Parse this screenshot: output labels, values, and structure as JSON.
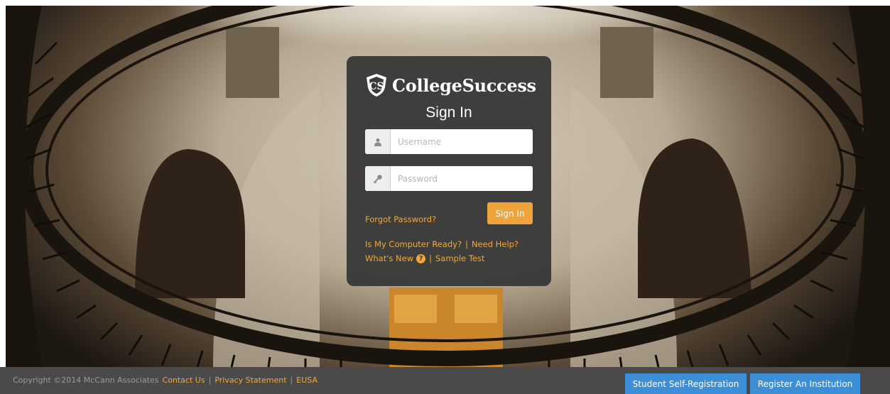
{
  "brand": {
    "name": "CollegeSuccess",
    "logo_icon": "cs-shield-icon"
  },
  "login": {
    "title": "Sign In",
    "username_placeholder": "Username",
    "password_placeholder": "Password",
    "username_icon": "user-icon",
    "password_icon": "key-icon",
    "forgot_label": "Forgot Password?",
    "signin_label": "Sign In"
  },
  "links": {
    "computer_ready": "Is My Computer Ready?",
    "need_help": "Need Help?",
    "whats_new": "What's New",
    "sample_test": "Sample Test",
    "separator": "|"
  },
  "footer": {
    "copyright": "Copyright ©2014 McCann Associates",
    "contact": "Contact Us",
    "privacy": "Privacy Statement",
    "eusa": "EUSA",
    "separator": "|",
    "student_reg": "Student Self-Registration",
    "register_inst": "Register An Institution"
  },
  "colors": {
    "accent": "#f0a33a",
    "card": "#3a3a3a",
    "footer": "#4a4a4a",
    "button_blue": "#3c8fd6"
  }
}
